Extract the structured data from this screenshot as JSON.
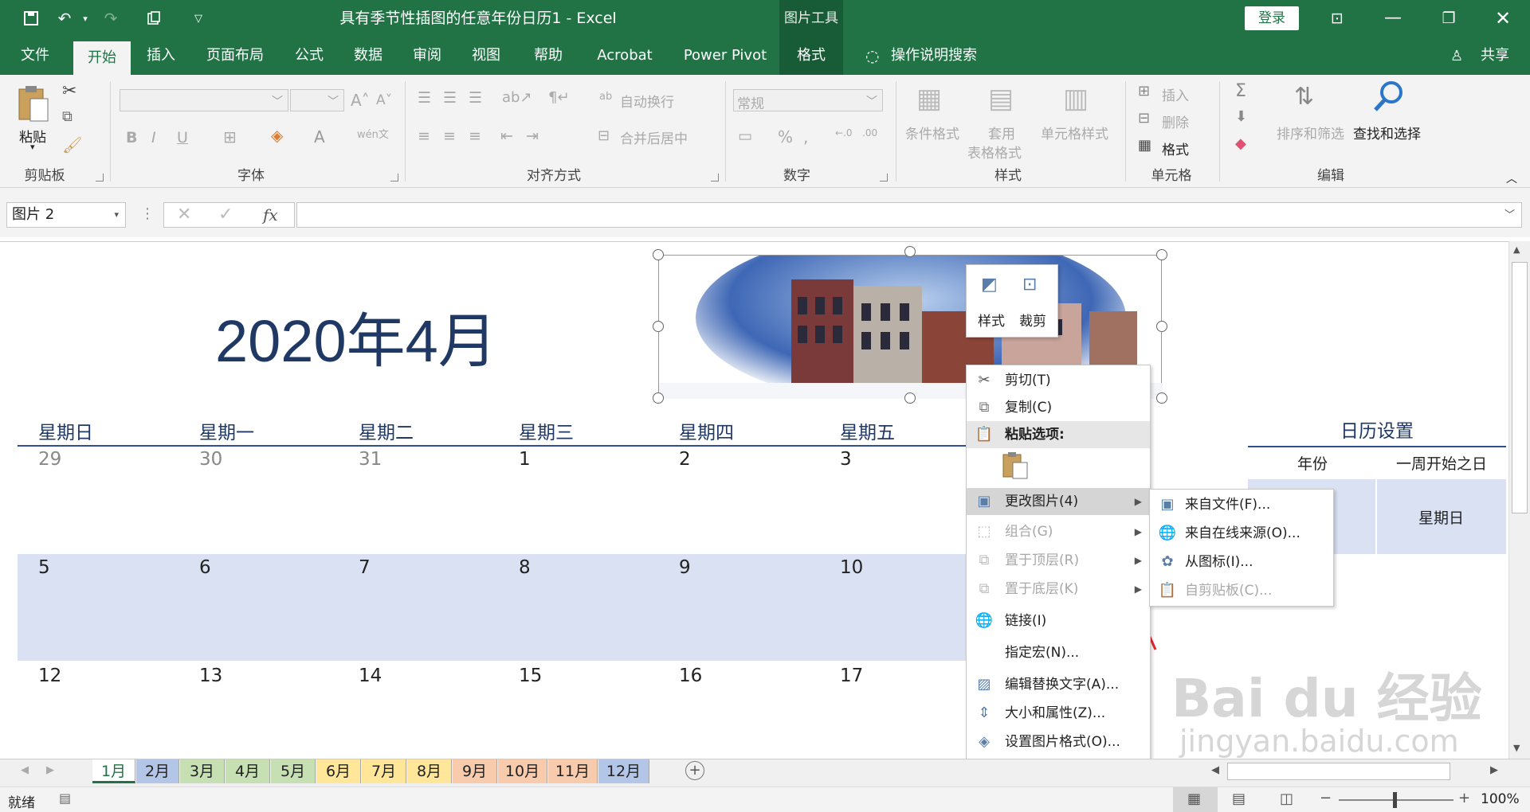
{
  "app": {
    "title": "具有季节性插图的任意年份日历1  -  Excel",
    "picture_tools": "图片工具",
    "login": "登录",
    "share": "共享",
    "accent": "#217346"
  },
  "tabs": [
    "文件",
    "开始",
    "插入",
    "页面布局",
    "公式",
    "数据",
    "审阅",
    "视图",
    "帮助",
    "Acrobat",
    "Power Pivot",
    "格式"
  ],
  "tell_me": "操作说明搜索",
  "ribbon": {
    "clipboard": {
      "label": "剪贴板",
      "paste": "粘贴"
    },
    "font": {
      "label": "字体"
    },
    "alignment": {
      "label": "对齐方式",
      "wrap": "自动换行",
      "merge": "合并后居中"
    },
    "number": {
      "label": "数字",
      "format": "常规"
    },
    "styles": {
      "label": "样式",
      "cond": "条件格式",
      "table1": "套用",
      "table2": "表格格式",
      "cell": "单元格样式"
    },
    "cells": {
      "label": "单元格",
      "insert": "插入",
      "delete": "删除",
      "format": "格式"
    },
    "editing": {
      "label": "编辑",
      "sort": "排序和筛选",
      "find": "查找和选择"
    }
  },
  "namebox": "图片 2",
  "fx": "fx",
  "calendar": {
    "title": "2020年4月",
    "days": [
      "星期日",
      "星期一",
      "星期二",
      "星期三",
      "星期四",
      "星期五"
    ],
    "weeks": [
      [
        "29",
        "30",
        "31",
        "1",
        "2",
        "3"
      ],
      [
        "5",
        "6",
        "7",
        "8",
        "9",
        "10"
      ],
      [
        "12",
        "13",
        "14",
        "15",
        "16",
        "17"
      ]
    ],
    "band_color": "#d9e1f2",
    "settings": {
      "title": "日历设置",
      "year": "年份",
      "week_start": "一周开始之日",
      "week_start_value": "星期日"
    }
  },
  "mini_toolbar": {
    "style": "样式",
    "crop": "裁剪"
  },
  "context_menu": {
    "cut": "剪切(T)",
    "copy": "复制(C)",
    "paste_options": "粘贴选项:",
    "change_picture": "更改图片(4)",
    "group": "组合(G)",
    "bring_front": "置于顶层(R)",
    "send_back": "置于底层(K)",
    "link": "链接(I)",
    "assign_macro": "指定宏(N)...",
    "edit_alt": "编辑替换文字(A)...",
    "size_props": "大小和属性(Z)...",
    "format_pic": "设置图片格式(O)..."
  },
  "submenu": {
    "from_file": "来自文件(F)...",
    "online": "来自在线来源(O)...",
    "from_icon": "从图标(I)...",
    "clipboard": "自剪贴板(C)..."
  },
  "sheet_tabs": [
    {
      "label": "1月",
      "color": "#ffffff"
    },
    {
      "label": "2月",
      "color": "#b4c6e7"
    },
    {
      "label": "3月",
      "color": "#c6e0b4"
    },
    {
      "label": "4月",
      "color": "#c6e0b4"
    },
    {
      "label": "5月",
      "color": "#c6e0b4"
    },
    {
      "label": "6月",
      "color": "#ffe699"
    },
    {
      "label": "7月",
      "color": "#ffe699"
    },
    {
      "label": "8月",
      "color": "#ffe699"
    },
    {
      "label": "9月",
      "color": "#f8cbad"
    },
    {
      "label": "10月",
      "color": "#f8cbad"
    },
    {
      "label": "11月",
      "color": "#f8cbad"
    },
    {
      "label": "12月",
      "color": "#b4c6e7"
    }
  ],
  "status": {
    "ready": "就绪",
    "zoom": "100%"
  },
  "watermark": {
    "brand": "Bai du 经验",
    "url": "jingyan.baidu.com"
  }
}
